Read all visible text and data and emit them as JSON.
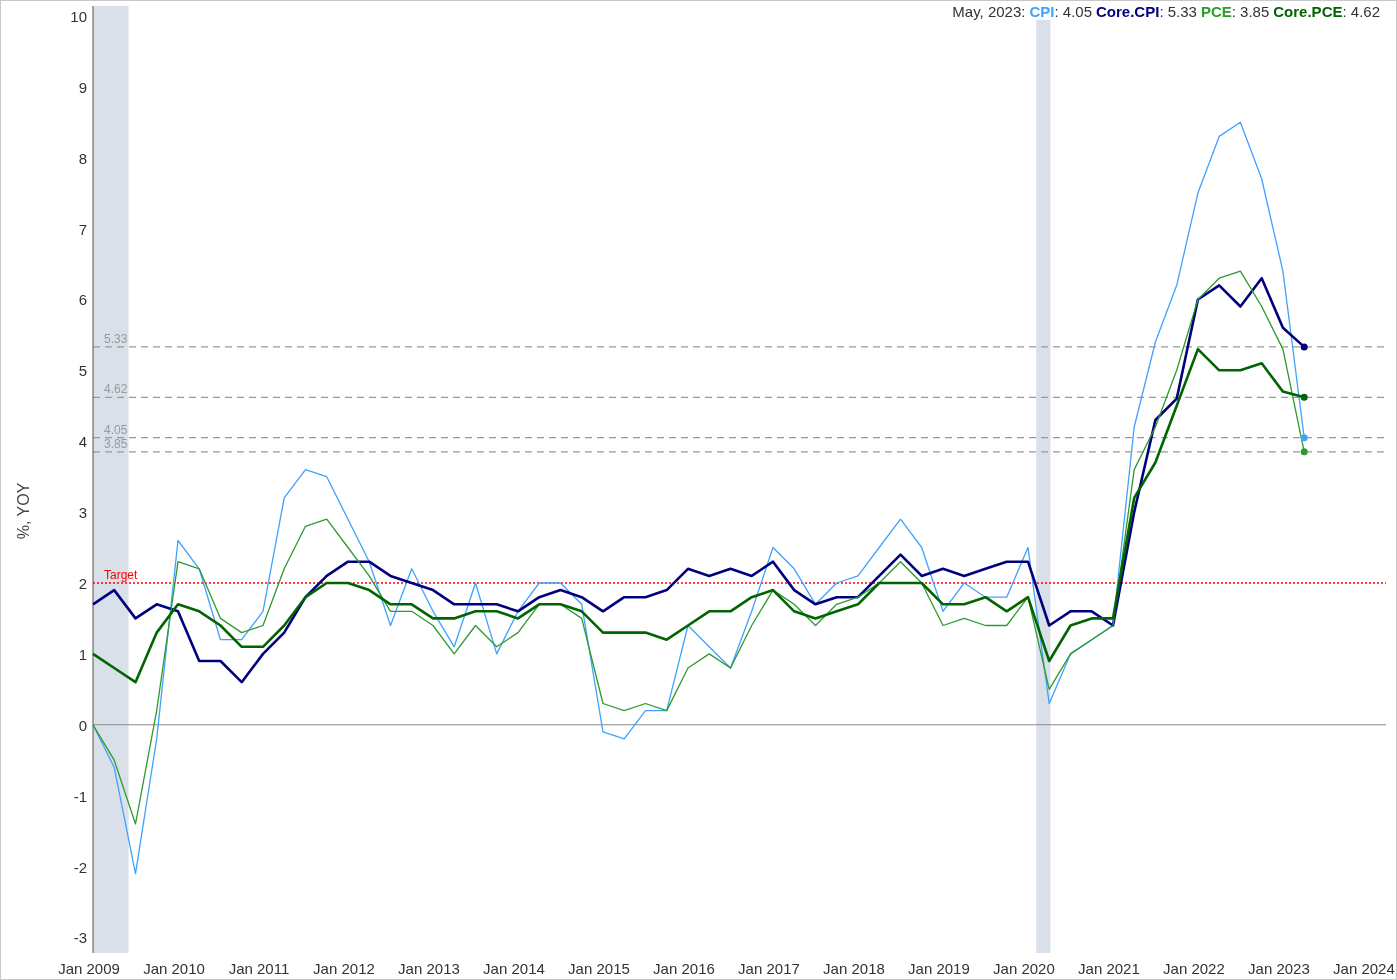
{
  "legend": {
    "date": "May, 2023:",
    "readings": [
      ": 4.05",
      ": 5.33",
      ": 3.85",
      ": 4.62"
    ]
  },
  "chart_data": {
    "type": "line",
    "ylabel": "%, YOY",
    "categories": [
      "Jan 2009",
      null,
      null,
      null,
      "Jan 2010",
      null,
      null,
      null,
      "Jan 2011",
      null,
      null,
      null,
      "Jan 2012",
      null,
      null,
      null,
      "Jan 2013",
      null,
      null,
      null,
      "Jan 2014",
      null,
      null,
      null,
      "Jan 2015",
      null,
      null,
      null,
      "Jan 2016",
      null,
      null,
      null,
      "Jan 2017",
      null,
      null,
      null,
      "Jan 2018",
      null,
      null,
      null,
      "Jan 2019",
      null,
      null,
      null,
      "Jan 2020",
      null,
      null,
      null,
      "Jan 2021",
      null,
      null,
      null,
      "Jan 2022",
      null,
      null,
      null,
      "Jan 2023",
      null,
      null,
      null,
      "Jan 2024"
    ],
    "series": [
      {
        "name": "CPI",
        "color": "#3fa2ff",
        "values": [
          0.0,
          -0.6,
          -2.1,
          -0.2,
          2.6,
          2.2,
          1.2,
          1.2,
          1.6,
          3.2,
          3.6,
          3.5,
          2.9,
          2.3,
          1.4,
          2.2,
          1.6,
          1.1,
          2.0,
          1.0,
          1.6,
          2.0,
          2.0,
          1.7,
          -0.1,
          -0.2,
          0.2,
          0.2,
          1.4,
          1.1,
          0.8,
          1.6,
          2.5,
          2.2,
          1.7,
          2.0,
          2.1,
          2.5,
          2.9,
          2.5,
          1.6,
          2.0,
          1.8,
          1.8,
          2.5,
          0.3,
          1.0,
          1.2,
          1.4,
          4.2,
          5.4,
          6.2,
          7.5,
          8.3,
          8.5,
          7.7,
          6.4,
          4.05,
          null,
          null,
          null
        ]
      },
      {
        "name": "Core.CPI",
        "color": "#00007f",
        "values": [
          1.7,
          1.9,
          1.5,
          1.7,
          1.6,
          0.9,
          0.9,
          0.6,
          1.0,
          1.3,
          1.8,
          2.1,
          2.3,
          2.3,
          2.1,
          2.0,
          1.9,
          1.7,
          1.7,
          1.7,
          1.6,
          1.8,
          1.9,
          1.8,
          1.6,
          1.8,
          1.8,
          1.9,
          2.2,
          2.1,
          2.2,
          2.1,
          2.3,
          1.9,
          1.7,
          1.8,
          1.8,
          2.1,
          2.4,
          2.1,
          2.2,
          2.1,
          2.2,
          2.3,
          2.3,
          1.4,
          1.6,
          1.6,
          1.4,
          3.0,
          4.3,
          4.6,
          6.0,
          6.2,
          5.9,
          6.3,
          5.6,
          5.33,
          null,
          null,
          null
        ]
      },
      {
        "name": "PCE",
        "color": "#2e9a2e",
        "values": [
          0.0,
          -0.5,
          -1.4,
          0.2,
          2.3,
          2.2,
          1.5,
          1.3,
          1.4,
          2.2,
          2.8,
          2.9,
          2.5,
          2.1,
          1.6,
          1.6,
          1.4,
          1.0,
          1.4,
          1.1,
          1.3,
          1.7,
          1.7,
          1.5,
          0.3,
          0.2,
          0.3,
          0.2,
          0.8,
          1.0,
          0.8,
          1.4,
          1.9,
          1.7,
          1.4,
          1.7,
          1.8,
          2.0,
          2.3,
          2.0,
          1.4,
          1.5,
          1.4,
          1.4,
          1.8,
          0.5,
          1.0,
          1.2,
          1.4,
          3.6,
          4.2,
          5.0,
          6.0,
          6.3,
          6.4,
          5.9,
          5.3,
          3.85,
          null,
          null,
          null
        ]
      },
      {
        "name": "Core.PCE",
        "color": "#006400",
        "values": [
          1.0,
          0.8,
          0.6,
          1.3,
          1.7,
          1.6,
          1.4,
          1.1,
          1.1,
          1.4,
          1.8,
          2.0,
          2.0,
          1.9,
          1.7,
          1.7,
          1.5,
          1.5,
          1.6,
          1.6,
          1.5,
          1.7,
          1.7,
          1.6,
          1.3,
          1.3,
          1.3,
          1.2,
          1.4,
          1.6,
          1.6,
          1.8,
          1.9,
          1.6,
          1.5,
          1.6,
          1.7,
          2.0,
          2.0,
          2.0,
          1.7,
          1.7,
          1.8,
          1.6,
          1.8,
          0.9,
          1.4,
          1.5,
          1.5,
          3.2,
          3.7,
          4.5,
          5.3,
          5.0,
          5.0,
          5.1,
          4.7,
          4.62,
          null,
          null,
          null
        ]
      }
    ],
    "ylim": [
      -3.22,
      10.14
    ],
    "yticks": [
      -3,
      -2,
      -1,
      0,
      1,
      2,
      3,
      4,
      5,
      6,
      7,
      8,
      9,
      10
    ],
    "ref_lines": [
      {
        "axis": "y",
        "value": 5.33,
        "label": "5.33",
        "color": "#999999"
      },
      {
        "axis": "y",
        "value": 4.62,
        "label": "4.62",
        "color": "#999999"
      },
      {
        "axis": "y",
        "value": 4.05,
        "label": "4.05",
        "color": "#999999"
      },
      {
        "axis": "y",
        "value": 3.85,
        "label": "3.85",
        "color": "#999999"
      },
      {
        "axis": "y",
        "value": 2,
        "label": "Target",
        "color": "#ff0000"
      }
    ]
  }
}
